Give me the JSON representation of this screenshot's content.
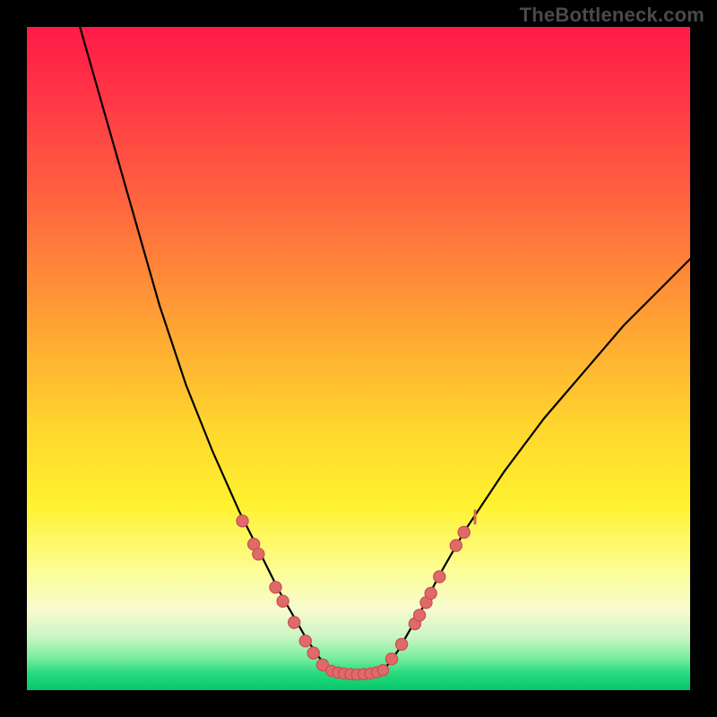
{
  "watermark": "TheBottleneck.com",
  "colors": {
    "frame": "#000000",
    "curve": "#000000",
    "dot_fill": "#e06a6a",
    "dot_stroke": "#c94f4f"
  },
  "chart_data": {
    "type": "line",
    "title": "",
    "xlabel": "",
    "ylabel": "",
    "xlim": [
      0,
      100
    ],
    "ylim": [
      0,
      100
    ],
    "grid": false,
    "legend": false,
    "series": [
      {
        "name": "left-curve",
        "x": [
          8,
          12,
          16,
          20,
          24,
          26,
          28,
          30,
          32,
          34,
          36,
          38,
          40,
          42,
          44,
          45.8
        ],
        "y": [
          100,
          86,
          72,
          58,
          46,
          41,
          36,
          31.5,
          27,
          23,
          19,
          15,
          11.5,
          8,
          5,
          3
        ]
      },
      {
        "name": "flat-min",
        "x": [
          45.8,
          47,
          48,
          49,
          50,
          51,
          52,
          53,
          53.8
        ],
        "y": [
          3,
          2.6,
          2.4,
          2.3,
          2.3,
          2.3,
          2.4,
          2.6,
          3
        ]
      },
      {
        "name": "right-curve",
        "x": [
          53.8,
          56,
          58,
          60,
          62,
          66,
          72,
          78,
          84,
          90,
          96,
          100
        ],
        "y": [
          3,
          6,
          9.5,
          13,
          17,
          24,
          33,
          41,
          48,
          55,
          61,
          65
        ]
      }
    ],
    "highlight_points": {
      "left_dots": [
        {
          "x": 32.5,
          "y": 25.5
        },
        {
          "x": 34.2,
          "y": 22
        },
        {
          "x": 34.9,
          "y": 20.5
        },
        {
          "x": 37.5,
          "y": 15.5
        },
        {
          "x": 38.6,
          "y": 13.4
        },
        {
          "x": 40.3,
          "y": 10.2
        },
        {
          "x": 42.0,
          "y": 7.4
        },
        {
          "x": 43.2,
          "y": 5.6
        },
        {
          "x": 44.6,
          "y": 3.8
        }
      ],
      "flat_dots": [
        {
          "x": 45.9,
          "y": 2.9
        },
        {
          "x": 46.9,
          "y": 2.65
        },
        {
          "x": 47.8,
          "y": 2.5
        },
        {
          "x": 48.8,
          "y": 2.4
        },
        {
          "x": 49.8,
          "y": 2.35
        },
        {
          "x": 50.8,
          "y": 2.4
        },
        {
          "x": 51.8,
          "y": 2.5
        },
        {
          "x": 52.8,
          "y": 2.7
        },
        {
          "x": 53.7,
          "y": 3.0
        }
      ],
      "right_dots": [
        {
          "x": 55.0,
          "y": 4.7
        },
        {
          "x": 56.5,
          "y": 6.9
        },
        {
          "x": 58.5,
          "y": 10.0
        },
        {
          "x": 59.2,
          "y": 11.3
        },
        {
          "x": 60.2,
          "y": 13.2
        },
        {
          "x": 60.9,
          "y": 14.6
        },
        {
          "x": 62.2,
          "y": 17.1
        },
        {
          "x": 64.7,
          "y": 21.8
        },
        {
          "x": 65.9,
          "y": 23.8
        }
      ],
      "right_tick": {
        "x": 67.3,
        "y": 26.1
      }
    }
  }
}
